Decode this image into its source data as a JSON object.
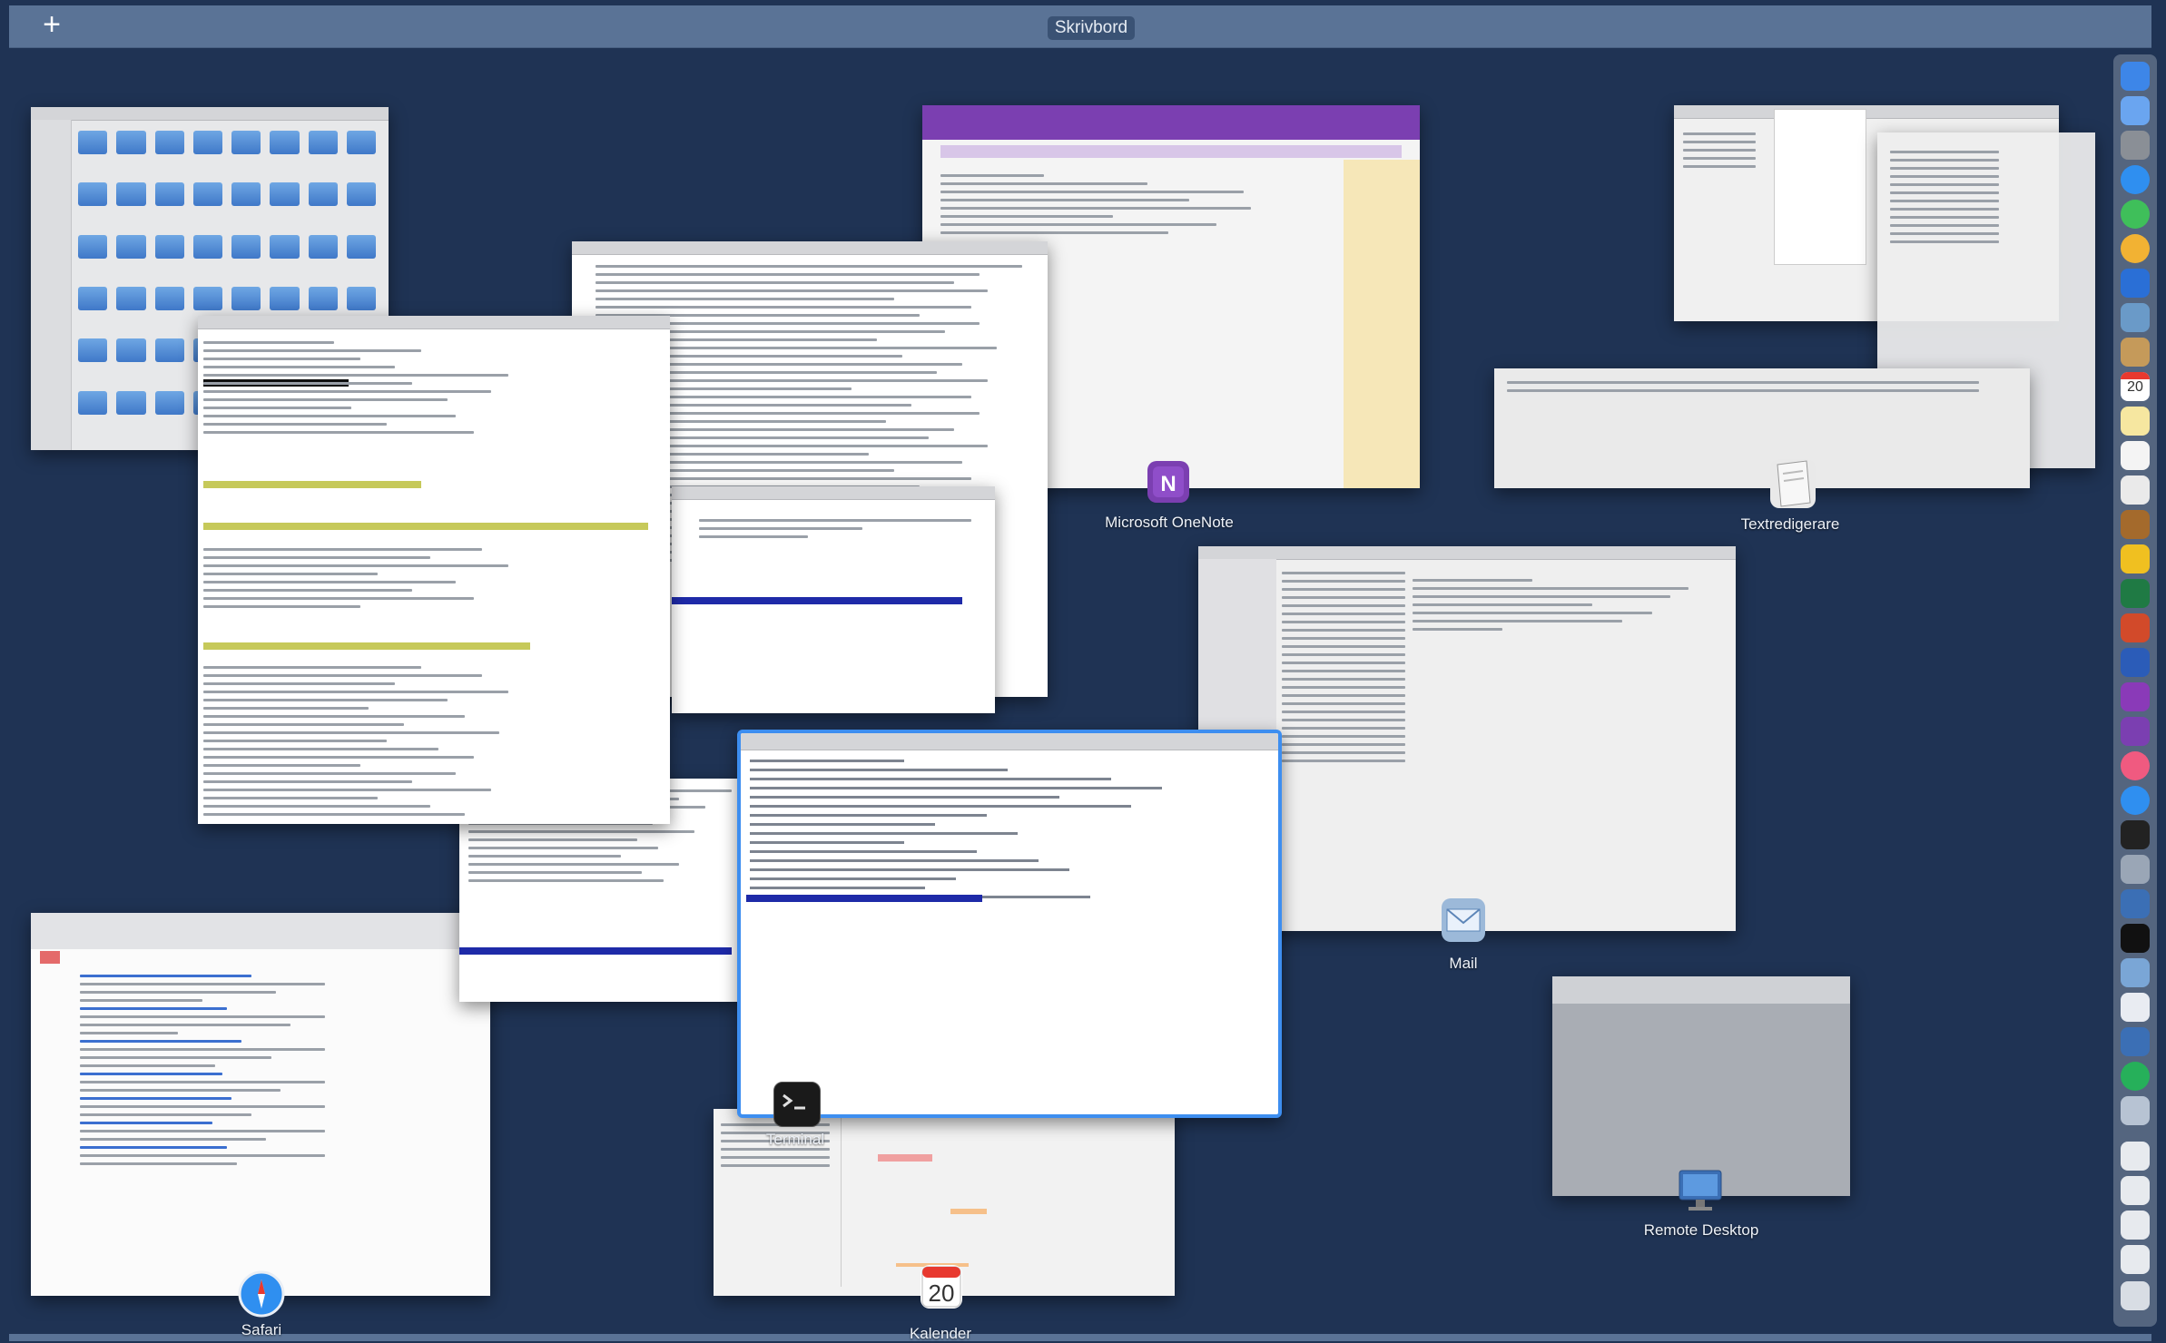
{
  "topbar": {
    "add_symbol": "+",
    "space_name": "Skrivbord"
  },
  "windows": {
    "onenote": {
      "label": "Microsoft OneNote",
      "icon": "onenote-icon"
    },
    "textedit": {
      "label": "Textredigerare",
      "icon": "textedit-icon"
    },
    "mail": {
      "label": "Mail",
      "icon": "mail-icon"
    },
    "remote_desktop": {
      "label": "Remote Desktop",
      "icon": "remote-desktop-icon"
    },
    "safari": {
      "label": "Safari",
      "icon": "safari-icon"
    },
    "calendar": {
      "label": "Kalender",
      "icon": "calendar-icon",
      "day": "20"
    },
    "terminal": {
      "label": "Terminal",
      "icon": "terminal-icon"
    },
    "finder": {
      "label": "",
      "icon": "finder-icon"
    }
  },
  "dock_calendar_day": "20",
  "colors": {
    "background": "#1f3354",
    "topbar": "#5a7396",
    "selection": "#3d8ef0",
    "onenote": "#7b3fb1",
    "notes_yellow": "#f6e7b8"
  }
}
